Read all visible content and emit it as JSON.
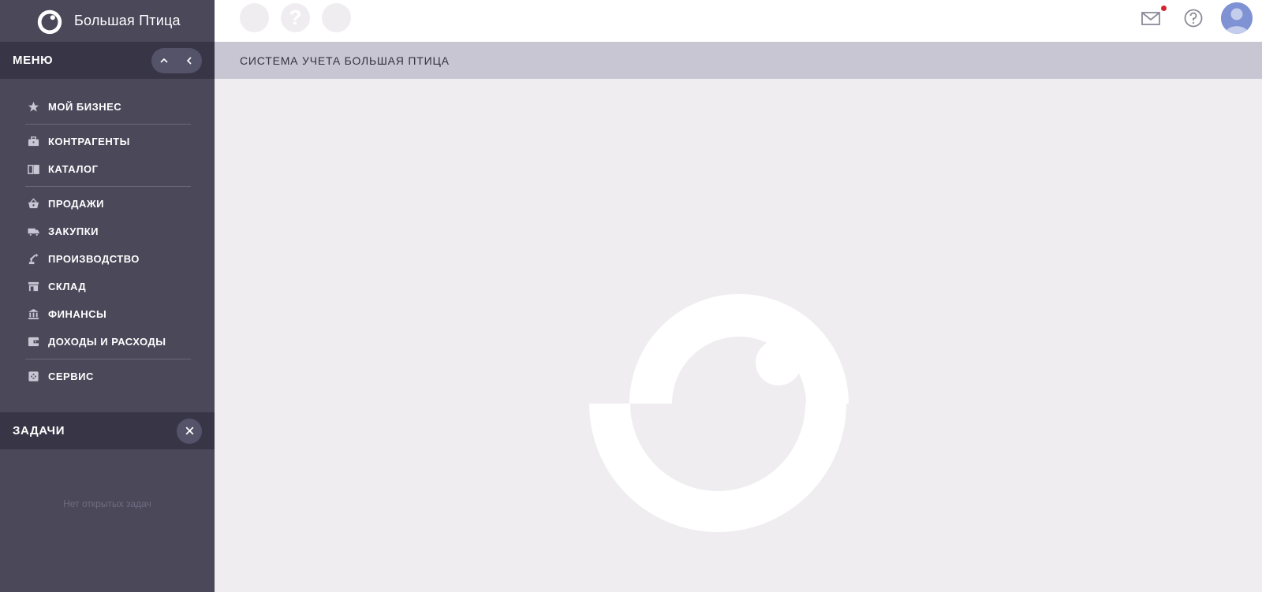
{
  "app": {
    "brand": "Большая Птица"
  },
  "sidebar": {
    "menu_title": "МЕНЮ",
    "items": [
      {
        "label": "МОЙ БИЗНЕС",
        "icon": "star-icon"
      },
      {
        "label": "КОНТРАГЕНТЫ",
        "icon": "briefcase-icon"
      },
      {
        "label": "КАТАЛОГ",
        "icon": "book-icon"
      },
      {
        "label": "ПРОДАЖИ",
        "icon": "basket-icon"
      },
      {
        "label": "ЗАКУПКИ",
        "icon": "truck-icon"
      },
      {
        "label": "ПРОИЗВОДСТВО",
        "icon": "robot-arm-icon"
      },
      {
        "label": "СКЛАД",
        "icon": "store-icon"
      },
      {
        "label": "ФИНАНСЫ",
        "icon": "bank-icon"
      },
      {
        "label": "ДОХОДЫ И РАСХОДЫ",
        "icon": "wallet-icon"
      },
      {
        "label": "СЕРВИС",
        "icon": "service-icon"
      }
    ],
    "tasks_title": "ЗАДАЧИ",
    "no_tasks": "Нет открытых задач"
  },
  "topbar": {
    "help_glyph": "?",
    "notification_color": "#d0262f"
  },
  "main": {
    "title": "СИСТЕМА УЧЕТА БОЛЬШАЯ ПТИЦА"
  },
  "colors": {
    "sidebar": "#4a4859",
    "sidebar_header": "#383646",
    "page_header": "#c8c6d2",
    "content_bg": "#efedf0",
    "avatar": "#7f92d4"
  }
}
